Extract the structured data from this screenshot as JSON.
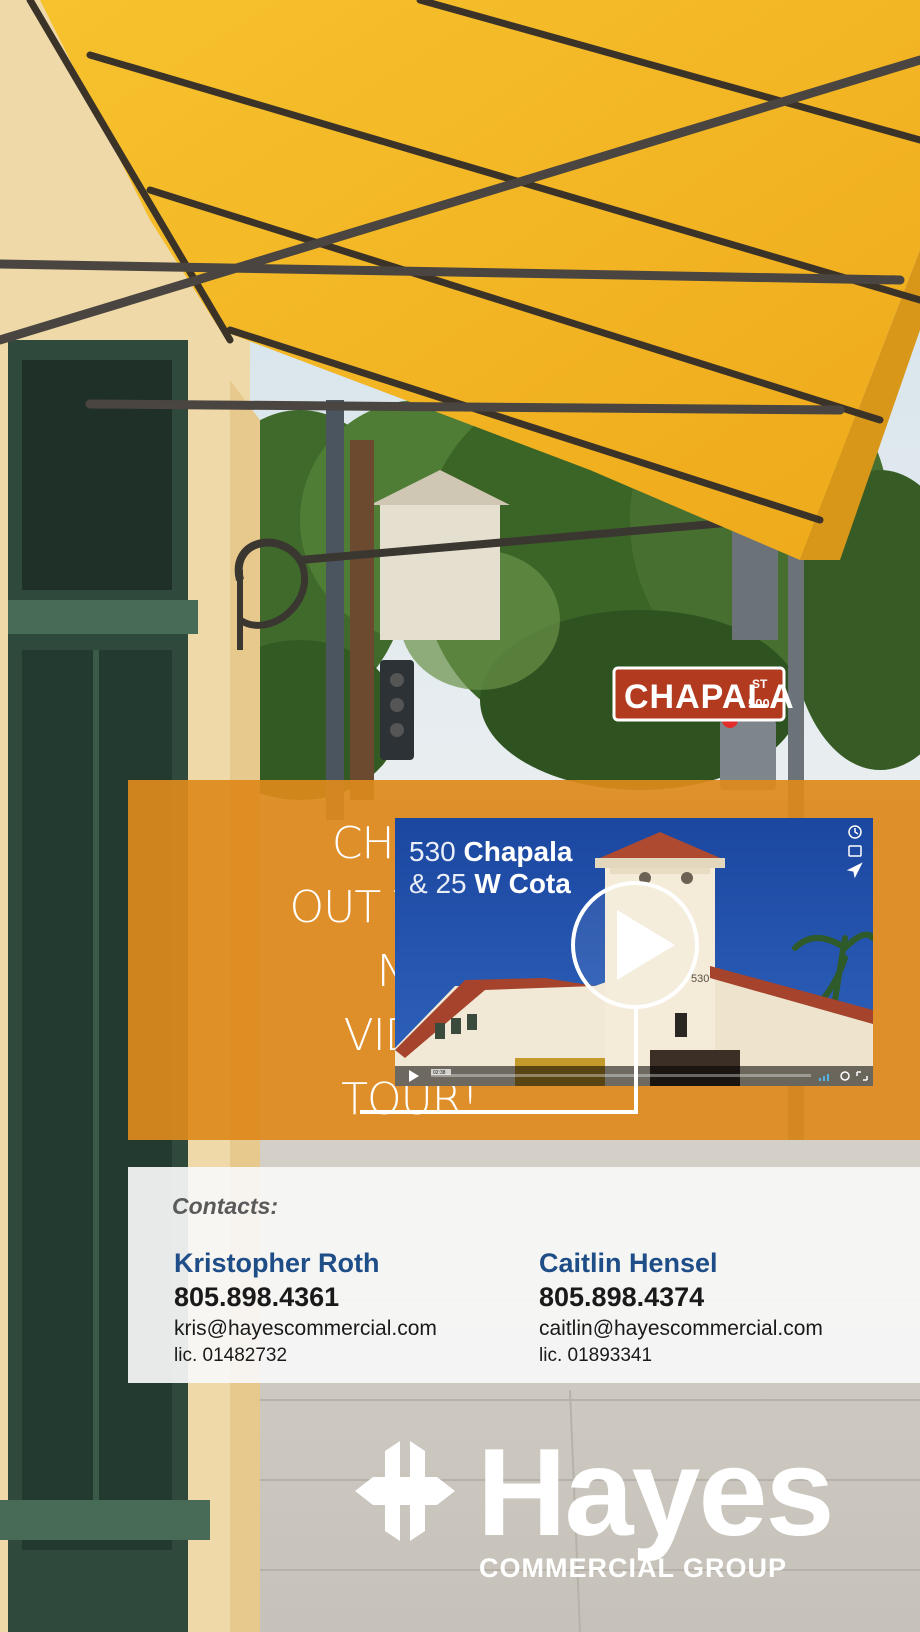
{
  "promo": {
    "headline_lines": [
      "CHECK",
      "OUT THE",
      "NEW",
      "VIDEO",
      "TOUR!"
    ]
  },
  "video": {
    "title_line1_light": "530",
    "title_line1_bold": "Chapala",
    "title_line2_light": "& 25",
    "title_line2_bold": "W Cota",
    "tower_number": "530",
    "timestamp": "02:38"
  },
  "street_sign": {
    "name": "CHAPALA",
    "suffix": "ST",
    "block": "500"
  },
  "contacts": {
    "label": "Contacts:",
    "people": [
      {
        "name": "Kristopher Roth",
        "phone": "805.898.4361",
        "email": "kris@hayescommercial.com",
        "license": "lic. 01482732"
      },
      {
        "name": "Caitlin Hensel",
        "phone": "805.898.4374",
        "email": "caitlin@hayescommercial.com",
        "license": "lic. 01893341"
      }
    ]
  },
  "logo": {
    "name": "Hayes",
    "subtitle": "COMMERCIAL GROUP",
    "mark_icon": "hayes-h-mark-icon"
  },
  "colors": {
    "awning": "#f4b521",
    "promo_orange": "#de8a1c",
    "contact_name_blue": "#1e4d87",
    "video_sky": "#1f4fa6",
    "street_sign_red": "#b23a1e"
  }
}
